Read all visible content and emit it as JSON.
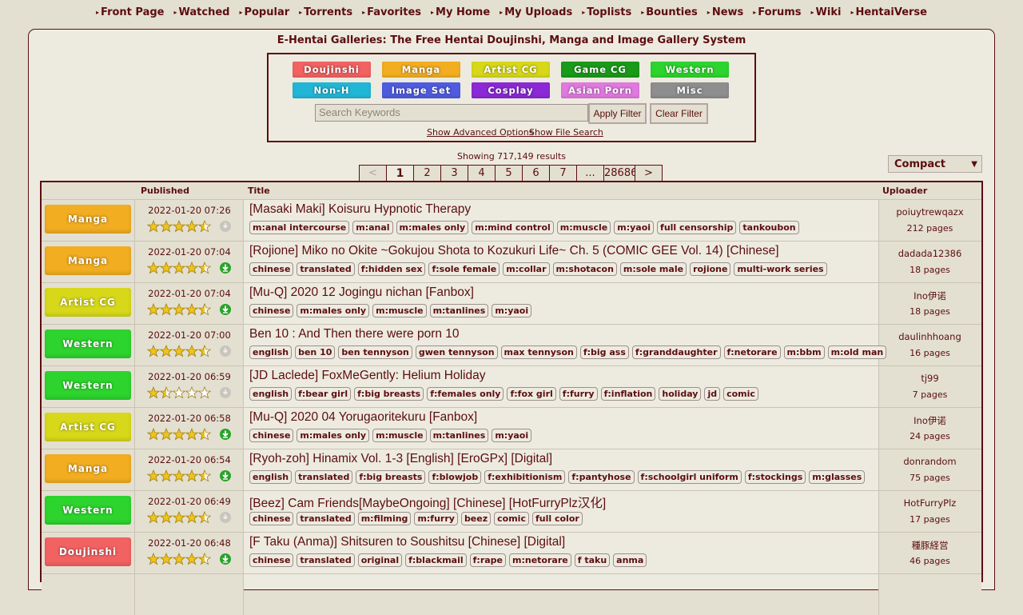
{
  "nav": [
    {
      "label": "Front Page"
    },
    {
      "label": "Watched"
    },
    {
      "label": "Popular"
    },
    {
      "label": "Torrents"
    },
    {
      "label": "Favorites"
    },
    {
      "label": "My Home"
    },
    {
      "label": "My Uploads"
    },
    {
      "label": "Toplists"
    },
    {
      "label": "Bounties"
    },
    {
      "label": "News"
    },
    {
      "label": "Forums"
    },
    {
      "label": "Wiki"
    },
    {
      "label": "HentaiVerse"
    }
  ],
  "page_title": "E-Hentai Galleries: The Free Hentai Doujinshi, Manga and Image Gallery System",
  "categories": [
    {
      "label": "Doujinshi",
      "color": "#f26262"
    },
    {
      "label": "Manga",
      "color": "#f2ad21"
    },
    {
      "label": "Artist CG",
      "color": "#d8d81a"
    },
    {
      "label": "Game CG",
      "color": "#1a9a1a"
    },
    {
      "label": "Western",
      "color": "#2dd42d"
    },
    {
      "label": "Non-H",
      "color": "#22b6d6"
    },
    {
      "label": "Image Set",
      "color": "#4f5ce0"
    },
    {
      "label": "Cosplay",
      "color": "#8b29d6"
    },
    {
      "label": "Asian Porn",
      "color": "#e07ae0"
    },
    {
      "label": "Misc",
      "color": "#8e8e8e"
    }
  ],
  "search": {
    "placeholder": "Search Keywords",
    "apply_label": "Apply Filter",
    "clear_label": "Clear Filter",
    "advanced_link": "Show Advanced Options",
    "file_search_link": "Show File Search"
  },
  "showing": "Showing 717,149 results",
  "pager": [
    "<",
    "1",
    "2",
    "3",
    "4",
    "5",
    "6",
    "7",
    "...",
    "28686",
    ">"
  ],
  "pager_current": "1",
  "view_mode": "Compact",
  "columns": {
    "published": "Published",
    "title": "Title",
    "uploader": "Uploader"
  },
  "colors": {
    "accent": "#5c0d11",
    "background": "#e3e0d1",
    "panel": "#edebdf",
    "torrent": "#29a329",
    "no_torrent": "#c8c5bd"
  },
  "rows": [
    {
      "category": "Manga",
      "cat_color": "#f2ad21",
      "published": "2022-01-20 07:26",
      "rating": 4.5,
      "torrent": false,
      "title": "[Masaki Maki] Koisuru Hypnotic Therapy",
      "tags": [
        "m:anal intercourse",
        "m:anal",
        "m:males only",
        "m:mind control",
        "m:muscle",
        "m:yaoi",
        "full censorship",
        "tankoubon"
      ],
      "uploader": "poiuytrewqazx",
      "pages": "212 pages"
    },
    {
      "category": "Manga",
      "cat_color": "#f2ad21",
      "published": "2022-01-20 07:04",
      "rating": 4.5,
      "torrent": true,
      "title": "[Rojione] Miko no Okite ~Gokujou Shota to Kozukuri Life~ Ch. 5 (COMIC GEE Vol. 14) [Chinese]",
      "tags": [
        "chinese",
        "translated",
        "f:hidden sex",
        "f:sole female",
        "m:collar",
        "m:shotacon",
        "m:sole male",
        "rojione",
        "multi-work series"
      ],
      "uploader": "dadada12386",
      "pages": "18 pages"
    },
    {
      "category": "Artist CG",
      "cat_color": "#d8d81a",
      "published": "2022-01-20 07:04",
      "rating": 4.5,
      "torrent": true,
      "title": "[Mu-Q] 2020 12 Jogingu nichan [Fanbox]",
      "tags": [
        "chinese",
        "m:males only",
        "m:muscle",
        "m:tanlines",
        "m:yaoi"
      ],
      "uploader": "Ino伊诺",
      "pages": "18 pages"
    },
    {
      "category": "Western",
      "cat_color": "#2dd42d",
      "published": "2022-01-20 07:00",
      "rating": 4.5,
      "torrent": false,
      "title": "Ben 10 : And Then there were porn 10",
      "tags": [
        "english",
        "ben 10",
        "ben tennyson",
        "gwen tennyson",
        "max tennyson",
        "f:big ass",
        "f:granddaughter",
        "f:netorare",
        "m:bbm",
        "m:old man"
      ],
      "uploader": "daulinhhoang",
      "pages": "16 pages"
    },
    {
      "category": "Western",
      "cat_color": "#2dd42d",
      "published": "2022-01-20 06:59",
      "rating": 1.5,
      "torrent": false,
      "title": "[JD Laclede] FoxMeGently: Helium Holiday",
      "tags": [
        "english",
        "f:bear girl",
        "f:big breasts",
        "f:females only",
        "f:fox girl",
        "f:furry",
        "f:inflation",
        "holiday",
        "jd",
        "comic"
      ],
      "uploader": "tj99",
      "pages": "7 pages"
    },
    {
      "category": "Artist CG",
      "cat_color": "#d8d81a",
      "published": "2022-01-20 06:58",
      "rating": 4.5,
      "torrent": true,
      "title": "[Mu-Q] 2020 04 Yorugaoritekuru [Fanbox]",
      "tags": [
        "chinese",
        "m:males only",
        "m:muscle",
        "m:tanlines",
        "m:yaoi"
      ],
      "uploader": "Ino伊诺",
      "pages": "24 pages"
    },
    {
      "category": "Manga",
      "cat_color": "#f2ad21",
      "published": "2022-01-20 06:54",
      "rating": 4.5,
      "torrent": true,
      "title": "[Ryoh-zoh] Hinamix Vol. 1-3 [English] [EroGPx] [Digital]",
      "tags": [
        "english",
        "translated",
        "f:big breasts",
        "f:blowjob",
        "f:exhibitionism",
        "f:pantyhose",
        "f:schoolgirl uniform",
        "f:stockings",
        "m:glasses"
      ],
      "uploader": "donrandom",
      "pages": "75 pages"
    },
    {
      "category": "Western",
      "cat_color": "#2dd42d",
      "published": "2022-01-20 06:49",
      "rating": 4.5,
      "torrent": false,
      "title": "[Beez] Cam Friends[MaybeOngoing] [Chinese] [HotFurryPlz汉化]",
      "tags": [
        "chinese",
        "translated",
        "m:filming",
        "m:furry",
        "beez",
        "comic",
        "full color"
      ],
      "uploader": "HotFurryPlz",
      "pages": "17 pages"
    },
    {
      "category": "Doujinshi",
      "cat_color": "#f26262",
      "published": "2022-01-20 06:48",
      "rating": 4.5,
      "torrent": true,
      "title": "[F Taku (Anma)] Shitsuren to Soushitsu [Chinese] [Digital]",
      "tags": [
        "chinese",
        "translated",
        "original",
        "f:blackmail",
        "f:rape",
        "m:netorare",
        "f taku",
        "anma"
      ],
      "uploader": "種豚経営",
      "pages": "46 pages"
    },
    {
      "category": "",
      "cat_color": "#e3e0d1",
      "published": "",
      "rating": 0,
      "torrent": false,
      "title": "",
      "tags": [],
      "uploader": "",
      "pages": ""
    }
  ]
}
